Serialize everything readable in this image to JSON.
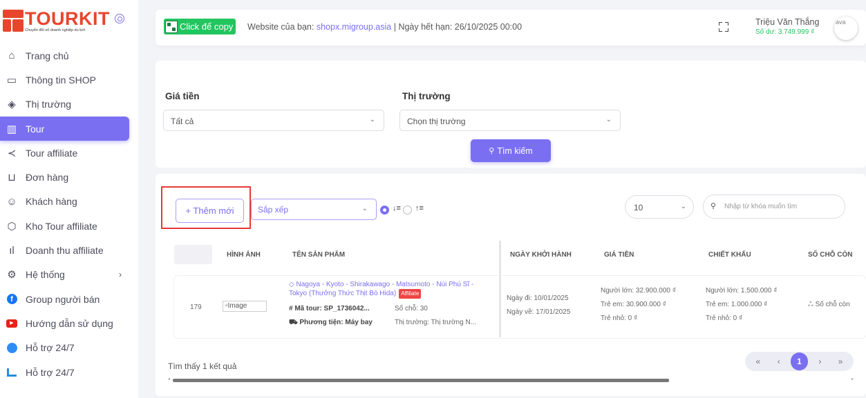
{
  "brand": {
    "name": "TOURKIT",
    "tagline": "Chuyển đổi số doanh nghiệp du lịch",
    "accent_color": "#7a6ff0",
    "logo_color": "#e8452c"
  },
  "sidebar": {
    "items": [
      {
        "label": "Trang chủ",
        "icon": "home-icon"
      },
      {
        "label": "Thông tin SHOP",
        "icon": "monitor-icon"
      },
      {
        "label": "Thị trường",
        "icon": "layers-icon"
      },
      {
        "label": "Tour",
        "icon": "map-icon",
        "active": true
      },
      {
        "label": "Tour affiliate",
        "icon": "share-icon"
      },
      {
        "label": "Đơn hàng",
        "icon": "cart-icon"
      },
      {
        "label": "Khách hàng",
        "icon": "users-icon"
      },
      {
        "label": "Kho Tour affiliate",
        "icon": "box-icon"
      },
      {
        "label": "Doanh thu affiliate",
        "icon": "bar-chart-icon"
      },
      {
        "label": "Hệ thống",
        "icon": "gear-icon",
        "has_submenu": true
      },
      {
        "label": "Group người bán",
        "icon": "facebook-icon"
      },
      {
        "label": "Hướng dẫn sử dụng",
        "icon": "youtube-icon"
      },
      {
        "label": "Hỗ trợ 24/7",
        "icon": "messenger-icon"
      },
      {
        "label": "Hỗ trợ 24/7",
        "icon": "zalo-icon"
      }
    ]
  },
  "topbar": {
    "copy_label": "Click để copy",
    "site_prefix": "Website của bạn: ",
    "site_url": "shopx.migroup.asia",
    "expiry": " | Ngày hết hạn: 26/10/2025 00:00",
    "user_name": "Triệu Văn Thắng",
    "balance": "Số dư: 3.749.999 ₫",
    "avatar_alt": "ava"
  },
  "filters": {
    "price_label": "Giá tiền",
    "price_value": "Tất cả",
    "market_label": "Thị trường",
    "market_value": "Chọn thị trường",
    "search_button": "Tìm kiếm"
  },
  "toolbar": {
    "add_button": "+ Thêm mới",
    "sort_placeholder": "Sắp xếp",
    "page_size": "10",
    "keyword_placeholder": "Nhập từ khóa muốn tìm"
  },
  "table": {
    "headers": [
      "HÌNH ẢNH",
      "TÊN SẢN PHẨM",
      "NGÀY KHỞI HÀNH",
      "GIÁ TIỀN",
      "CHIẾT KHẤU",
      "SỐ CHỖ CÒN"
    ],
    "row": {
      "id": "179",
      "image_alt": "Image",
      "name": "Nagoya - Kyoto - Shirakawago - Matsumoto - Núi Phú Sĩ - Tokyo (Thưởng Thức Thịt Bò Hida)",
      "badge": "Affiliate",
      "tour_code": "# Mã tour: SP_1736042...",
      "seats": "Số chỗ: 30",
      "transport": "Phương tiện: Máy bay",
      "market": "Thị trường: Thị trường N...",
      "depart": "Ngày đi: 10/01/2025",
      "return": "Ngày về: 17/01/2025",
      "price_adult": "Người lớn: 32.900.000 ₫",
      "price_child": "Trẻ em: 30.900.000 ₫",
      "price_infant": "Trẻ nhỏ: 0 ₫",
      "disc_adult": "Người lớn: 1.500.000 ₫",
      "disc_child": "Trẻ em: 1.000.000 ₫",
      "disc_infant": "Trẻ nhỏ: 0 ₫",
      "remaining": "Số chỗ còn"
    }
  },
  "footer": {
    "result_text": "Tìm thấy 1 kết quả",
    "pager": {
      "first": "«",
      "prev": "‹",
      "current": "1",
      "next": "›",
      "last": "»"
    }
  }
}
